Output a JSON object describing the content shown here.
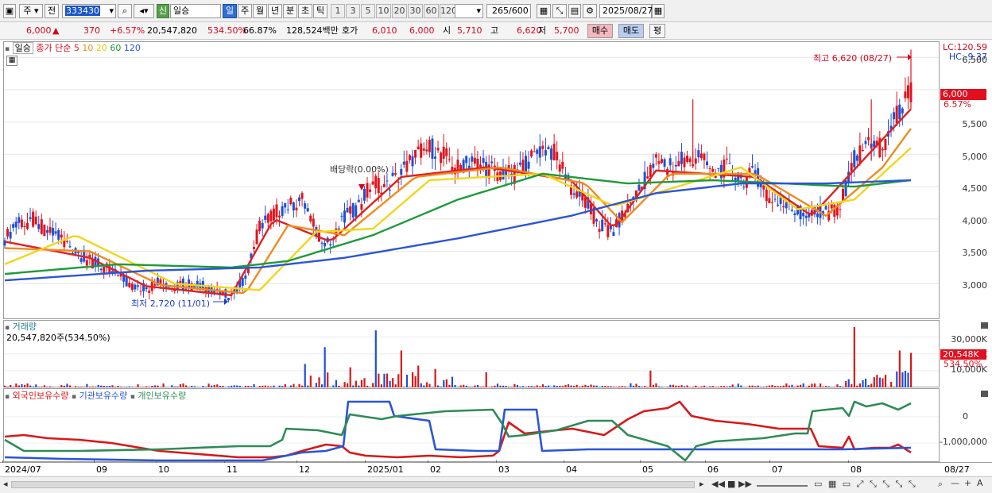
{
  "toolbar": {
    "period_main": "주",
    "jeon": "전",
    "stock_code": "333430",
    "new_badge": "신",
    "stock_name": "일승",
    "period_tabs": [
      "일",
      "주",
      "월",
      "년",
      "분",
      "초",
      "틱"
    ],
    "period_selected": "일",
    "interval_tabs": [
      "1",
      "3",
      "5",
      "10",
      "20",
      "30",
      "60",
      "120"
    ],
    "count": "265",
    "count_max": "/600",
    "date": "2025/08/27"
  },
  "quote": {
    "price": "6,000",
    "arrow": "▲",
    "change": "370",
    "change_pct": "+6.57%",
    "volume": "20,547,820",
    "vol_ratio": "534.50%",
    "turnover": "66.87%",
    "amount": "128,524백만",
    "hoga_label": "호가",
    "hoga_ask": "6,010",
    "hoga_bid": "6,000",
    "open_label": "시",
    "open": "5,710",
    "high_label": "고",
    "high": "6,620",
    "low_label": "저",
    "low": "5,700",
    "buy_btn": "매수",
    "sell_btn": "매도",
    "pyeong_btn": "평"
  },
  "price_pane": {
    "name_tag": "일승",
    "legend_prefix": "종가 단순",
    "ma_periods": [
      "5",
      "10",
      "20",
      "60",
      "120"
    ],
    "ma_colors": [
      "#e02020",
      "#f08a1c",
      "#f2d51a",
      "#1e9a3a",
      "#2a55d8"
    ],
    "y_ticks": [
      "6,500",
      "6,000",
      "5,500",
      "5,000",
      "4,500",
      "4,000",
      "3,500",
      "3,000"
    ],
    "lc": "LC:120.59",
    "hc": "HC:-9.37",
    "last_price_box": "6,000",
    "last_pct": "6.57%",
    "high_note": "최고 6,620 (08/27)",
    "low_note": "최저 2,720 (11/01)",
    "dividend_note": "배당락(0.00%)"
  },
  "volume_pane": {
    "title": "거래량",
    "value_text": "20,547,820주(534.50%)",
    "y_ticks": [
      "30,000K",
      "20,000K",
      "10,000K"
    ],
    "last_box": "20,548K",
    "last_pct": "534.50%"
  },
  "holding_pane": {
    "legends": [
      "외국인보유수량",
      "기관보유수량",
      "개인보유수량"
    ],
    "legend_colors": [
      "#d81818",
      "#2a55d8",
      "#2e8b57"
    ],
    "y_ticks": [
      "0",
      "-1,000,000"
    ]
  },
  "x_axis": {
    "labels": [
      "2024/07",
      "09",
      "10",
      "11",
      "12",
      "2025/01",
      "02",
      "03",
      "04",
      "05",
      "06",
      "07",
      "08"
    ],
    "last_date": "08/27"
  },
  "chart_data": {
    "type": "candlestick",
    "x_range": [
      "2024/07",
      "2025/08/27"
    ],
    "ylim": [
      2500,
      6700
    ],
    "close_path": [
      [
        0,
        3700
      ],
      [
        5,
        3950
      ],
      [
        10,
        4000
      ],
      [
        15,
        3800
      ],
      [
        20,
        3700
      ],
      [
        25,
        3500
      ],
      [
        30,
        3350
      ],
      [
        35,
        3250
      ],
      [
        40,
        3100
      ],
      [
        45,
        2950
      ],
      [
        50,
        2950
      ],
      [
        55,
        3000
      ],
      [
        60,
        2980
      ],
      [
        65,
        3000
      ],
      [
        70,
        2950
      ],
      [
        75,
        2900
      ],
      [
        80,
        2800
      ],
      [
        85,
        3100
      ],
      [
        90,
        3900
      ],
      [
        95,
        4100
      ],
      [
        100,
        4200
      ],
      [
        105,
        4300
      ],
      [
        110,
        3800
      ],
      [
        115,
        3600
      ],
      [
        120,
        4000
      ],
      [
        125,
        4200
      ],
      [
        130,
        4600
      ],
      [
        135,
        4500
      ],
      [
        140,
        4700
      ],
      [
        145,
        5000
      ],
      [
        150,
        5100
      ],
      [
        155,
        5000
      ],
      [
        160,
        4800
      ],
      [
        165,
        4900
      ],
      [
        170,
        4800
      ],
      [
        175,
        4700
      ],
      [
        180,
        4700
      ],
      [
        185,
        4900
      ],
      [
        190,
        5100
      ],
      [
        195,
        5000
      ],
      [
        200,
        4500
      ],
      [
        205,
        4300
      ],
      [
        210,
        3900
      ],
      [
        215,
        3800
      ],
      [
        220,
        4200
      ],
      [
        225,
        4500
      ],
      [
        230,
        4900
      ],
      [
        235,
        4800
      ],
      [
        240,
        4900
      ],
      [
        245,
        5000
      ],
      [
        250,
        4700
      ],
      [
        255,
        4800
      ],
      [
        260,
        4600
      ],
      [
        265,
        4700
      ],
      [
        270,
        4350
      ],
      [
        275,
        4200
      ],
      [
        280,
        4100
      ],
      [
        285,
        4050
      ],
      [
        290,
        4100
      ],
      [
        295,
        4200
      ],
      [
        300,
        4900
      ],
      [
        305,
        5200
      ],
      [
        310,
        5100
      ],
      [
        315,
        5600
      ],
      [
        320,
        6000
      ]
    ],
    "ma_series": [
      {
        "name": "5",
        "color": "#e02020",
        "values": [
          [
            0,
            3650
          ],
          [
            30,
            3400
          ],
          [
            50,
            2960
          ],
          [
            80,
            2820
          ],
          [
            95,
            4000
          ],
          [
            115,
            3650
          ],
          [
            140,
            4650
          ],
          [
            170,
            4800
          ],
          [
            200,
            4600
          ],
          [
            215,
            3850
          ],
          [
            230,
            4750
          ],
          [
            265,
            4650
          ],
          [
            285,
            4050
          ],
          [
            305,
            5000
          ],
          [
            320,
            5700
          ]
        ]
      },
      {
        "name": "10",
        "color": "#f08a1c",
        "values": [
          [
            0,
            3550
          ],
          [
            30,
            3500
          ],
          [
            55,
            2980
          ],
          [
            85,
            2850
          ],
          [
            100,
            3900
          ],
          [
            120,
            3750
          ],
          [
            145,
            4650
          ],
          [
            175,
            4800
          ],
          [
            205,
            4550
          ],
          [
            218,
            3950
          ],
          [
            235,
            4700
          ],
          [
            265,
            4700
          ],
          [
            290,
            4050
          ],
          [
            310,
            4800
          ],
          [
            320,
            5400
          ]
        ]
      },
      {
        "name": "20",
        "color": "#f2d51a",
        "values": [
          [
            0,
            3300
          ],
          [
            25,
            3750
          ],
          [
            60,
            3000
          ],
          [
            90,
            2900
          ],
          [
            110,
            3800
          ],
          [
            130,
            3850
          ],
          [
            150,
            4600
          ],
          [
            190,
            4700
          ],
          [
            215,
            4200
          ],
          [
            230,
            4400
          ],
          [
            260,
            4800
          ],
          [
            280,
            4150
          ],
          [
            300,
            4300
          ],
          [
            320,
            5100
          ]
        ]
      },
      {
        "name": "60",
        "color": "#1e9a3a",
        "values": [
          [
            0,
            3150
          ],
          [
            40,
            3300
          ],
          [
            80,
            3250
          ],
          [
            100,
            3350
          ],
          [
            130,
            3750
          ],
          [
            160,
            4300
          ],
          [
            190,
            4700
          ],
          [
            220,
            4550
          ],
          [
            250,
            4600
          ],
          [
            275,
            4550
          ],
          [
            300,
            4500
          ],
          [
            320,
            4600
          ]
        ]
      },
      {
        "name": "120",
        "color": "#2a55d8",
        "values": [
          [
            0,
            3050
          ],
          [
            50,
            3200
          ],
          [
            90,
            3250
          ],
          [
            120,
            3400
          ],
          [
            160,
            3700
          ],
          [
            200,
            4050
          ],
          [
            230,
            4400
          ],
          [
            260,
            4550
          ],
          [
            290,
            4550
          ],
          [
            320,
            4600
          ]
        ]
      }
    ],
    "annotations": [
      {
        "text": "최고 6,620 (08/27)",
        "value": 6620
      },
      {
        "text": "최저 2,720 (11/01)",
        "value": 2720
      },
      {
        "text": "배당락(0.00%)"
      }
    ],
    "volume": {
      "ylim": [
        0,
        35000
      ],
      "spikes": [
        [
          106,
          14000
        ],
        [
          113,
          24000
        ],
        [
          122,
          12000
        ],
        [
          131,
          34000
        ],
        [
          140,
          22000
        ],
        [
          146,
          13000
        ],
        [
          152,
          11000
        ],
        [
          170,
          9000
        ],
        [
          228,
          10000
        ],
        [
          300,
          36000
        ],
        [
          316,
          22000
        ],
        [
          320,
          20548
        ]
      ]
    },
    "holdings": {
      "ylim": [
        -1500000,
        500000
      ],
      "series": [
        {
          "name": "외국인보유수량",
          "color": "#d81818"
        },
        {
          "name": "기관보유수량",
          "color": "#2a55d8"
        },
        {
          "name": "개인보유수량",
          "color": "#2e8b57"
        }
      ]
    }
  }
}
